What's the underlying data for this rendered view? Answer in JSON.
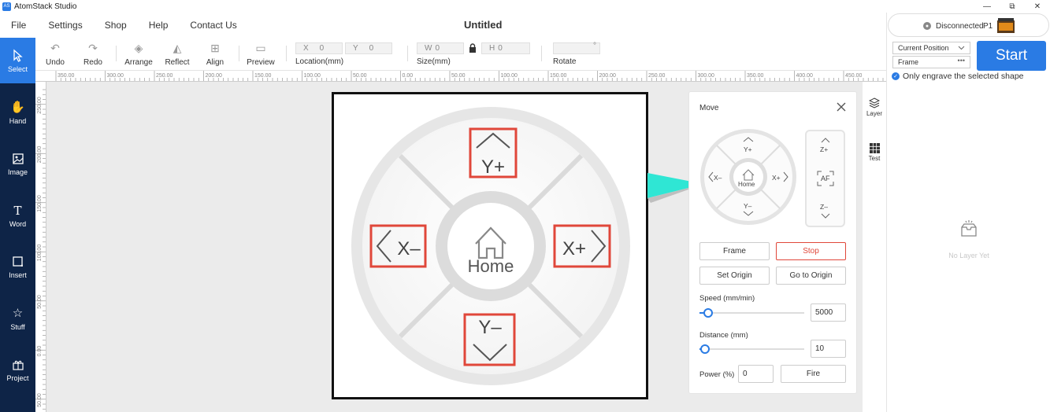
{
  "app": {
    "name": "AtomStack Studio",
    "logo_text": "AS",
    "document_title": "Untitled"
  },
  "window_controls": {
    "minimize": "—",
    "restore": "⧉",
    "close": "✕"
  },
  "menu": [
    "File",
    "Settings",
    "Shop",
    "Help",
    "Contact Us"
  ],
  "toolbar": {
    "undo": "Undo",
    "redo": "Redo",
    "arrange": "Arrange",
    "reflect": "Reflect",
    "align": "Align",
    "preview": "Preview",
    "x_label": "X",
    "x_value": "0",
    "y_label": "Y",
    "y_value": "0",
    "location_label": "Location(mm)",
    "w_label": "W",
    "w_value": "0",
    "h_label": "H",
    "h_value": "0",
    "size_label": "Size(mm)",
    "rotate_label": "Rotate",
    "rotate_unit": "°"
  },
  "sidebar": [
    {
      "label": "Select",
      "icon": "cursor-icon",
      "active": true
    },
    {
      "label": "Hand",
      "icon": "hand-icon"
    },
    {
      "label": "Image",
      "icon": "image-icon"
    },
    {
      "label": "Word",
      "icon": "text-icon"
    },
    {
      "label": "Insert",
      "icon": "insert-icon"
    },
    {
      "label": "Stuff",
      "icon": "star-icon"
    },
    {
      "label": "Project",
      "icon": "gift-icon"
    }
  ],
  "ruler": {
    "h_ticks": [
      "350.00",
      "300.00",
      "250.00",
      "200.00",
      "150.00",
      "100.00",
      "50.00",
      "0.00",
      "50.00",
      "100.00",
      "150.00",
      "200.00",
      "250.00",
      "300.00",
      "350.00",
      "400.00",
      "450.00"
    ],
    "v_ticks": [
      "250.00",
      "200.00",
      "150.00",
      "100.00",
      "50.00",
      "0.00",
      "50.00"
    ]
  },
  "zoom": {
    "y_plus": "Y+",
    "y_minus": "Y–",
    "x_minus": "X–",
    "x_plus": "X+",
    "home": "Home"
  },
  "move_panel": {
    "title": "Move",
    "jog": {
      "y_plus": "Y+",
      "y_minus": "Y–",
      "x_minus": "X–",
      "x_plus": "X+",
      "home": "Home",
      "z_plus": "Z+",
      "z_minus": "Z–",
      "af": "AF"
    },
    "frame": "Frame",
    "stop": "Stop",
    "set_origin": "Set Origin",
    "go_to_origin": "Go to Origin",
    "speed_label": "Speed (mm/min)",
    "speed_value": "5000",
    "speed_fraction": 0.08,
    "distance_label": "Distance (mm)",
    "distance_value": "10",
    "distance_fraction": 0.05,
    "power_label": "Power (%)",
    "power_value": "0",
    "fire": "Fire"
  },
  "right_tabs": {
    "layer": "Layer",
    "test": "Test"
  },
  "right_panel": {
    "status": "Disconnected",
    "device": "P1",
    "position_select": "Current Position",
    "mode_select": "Frame",
    "mode_more": "•••",
    "start": "Start",
    "only_engrave": "Only engrave the selected shape",
    "empty": "No Layer Yet"
  },
  "colors": {
    "accent": "#2a7be4",
    "sidebar": "#0e2447",
    "stop": "#e0473a",
    "highlight": "#e0473a",
    "arrow": "#2fe6d4"
  }
}
